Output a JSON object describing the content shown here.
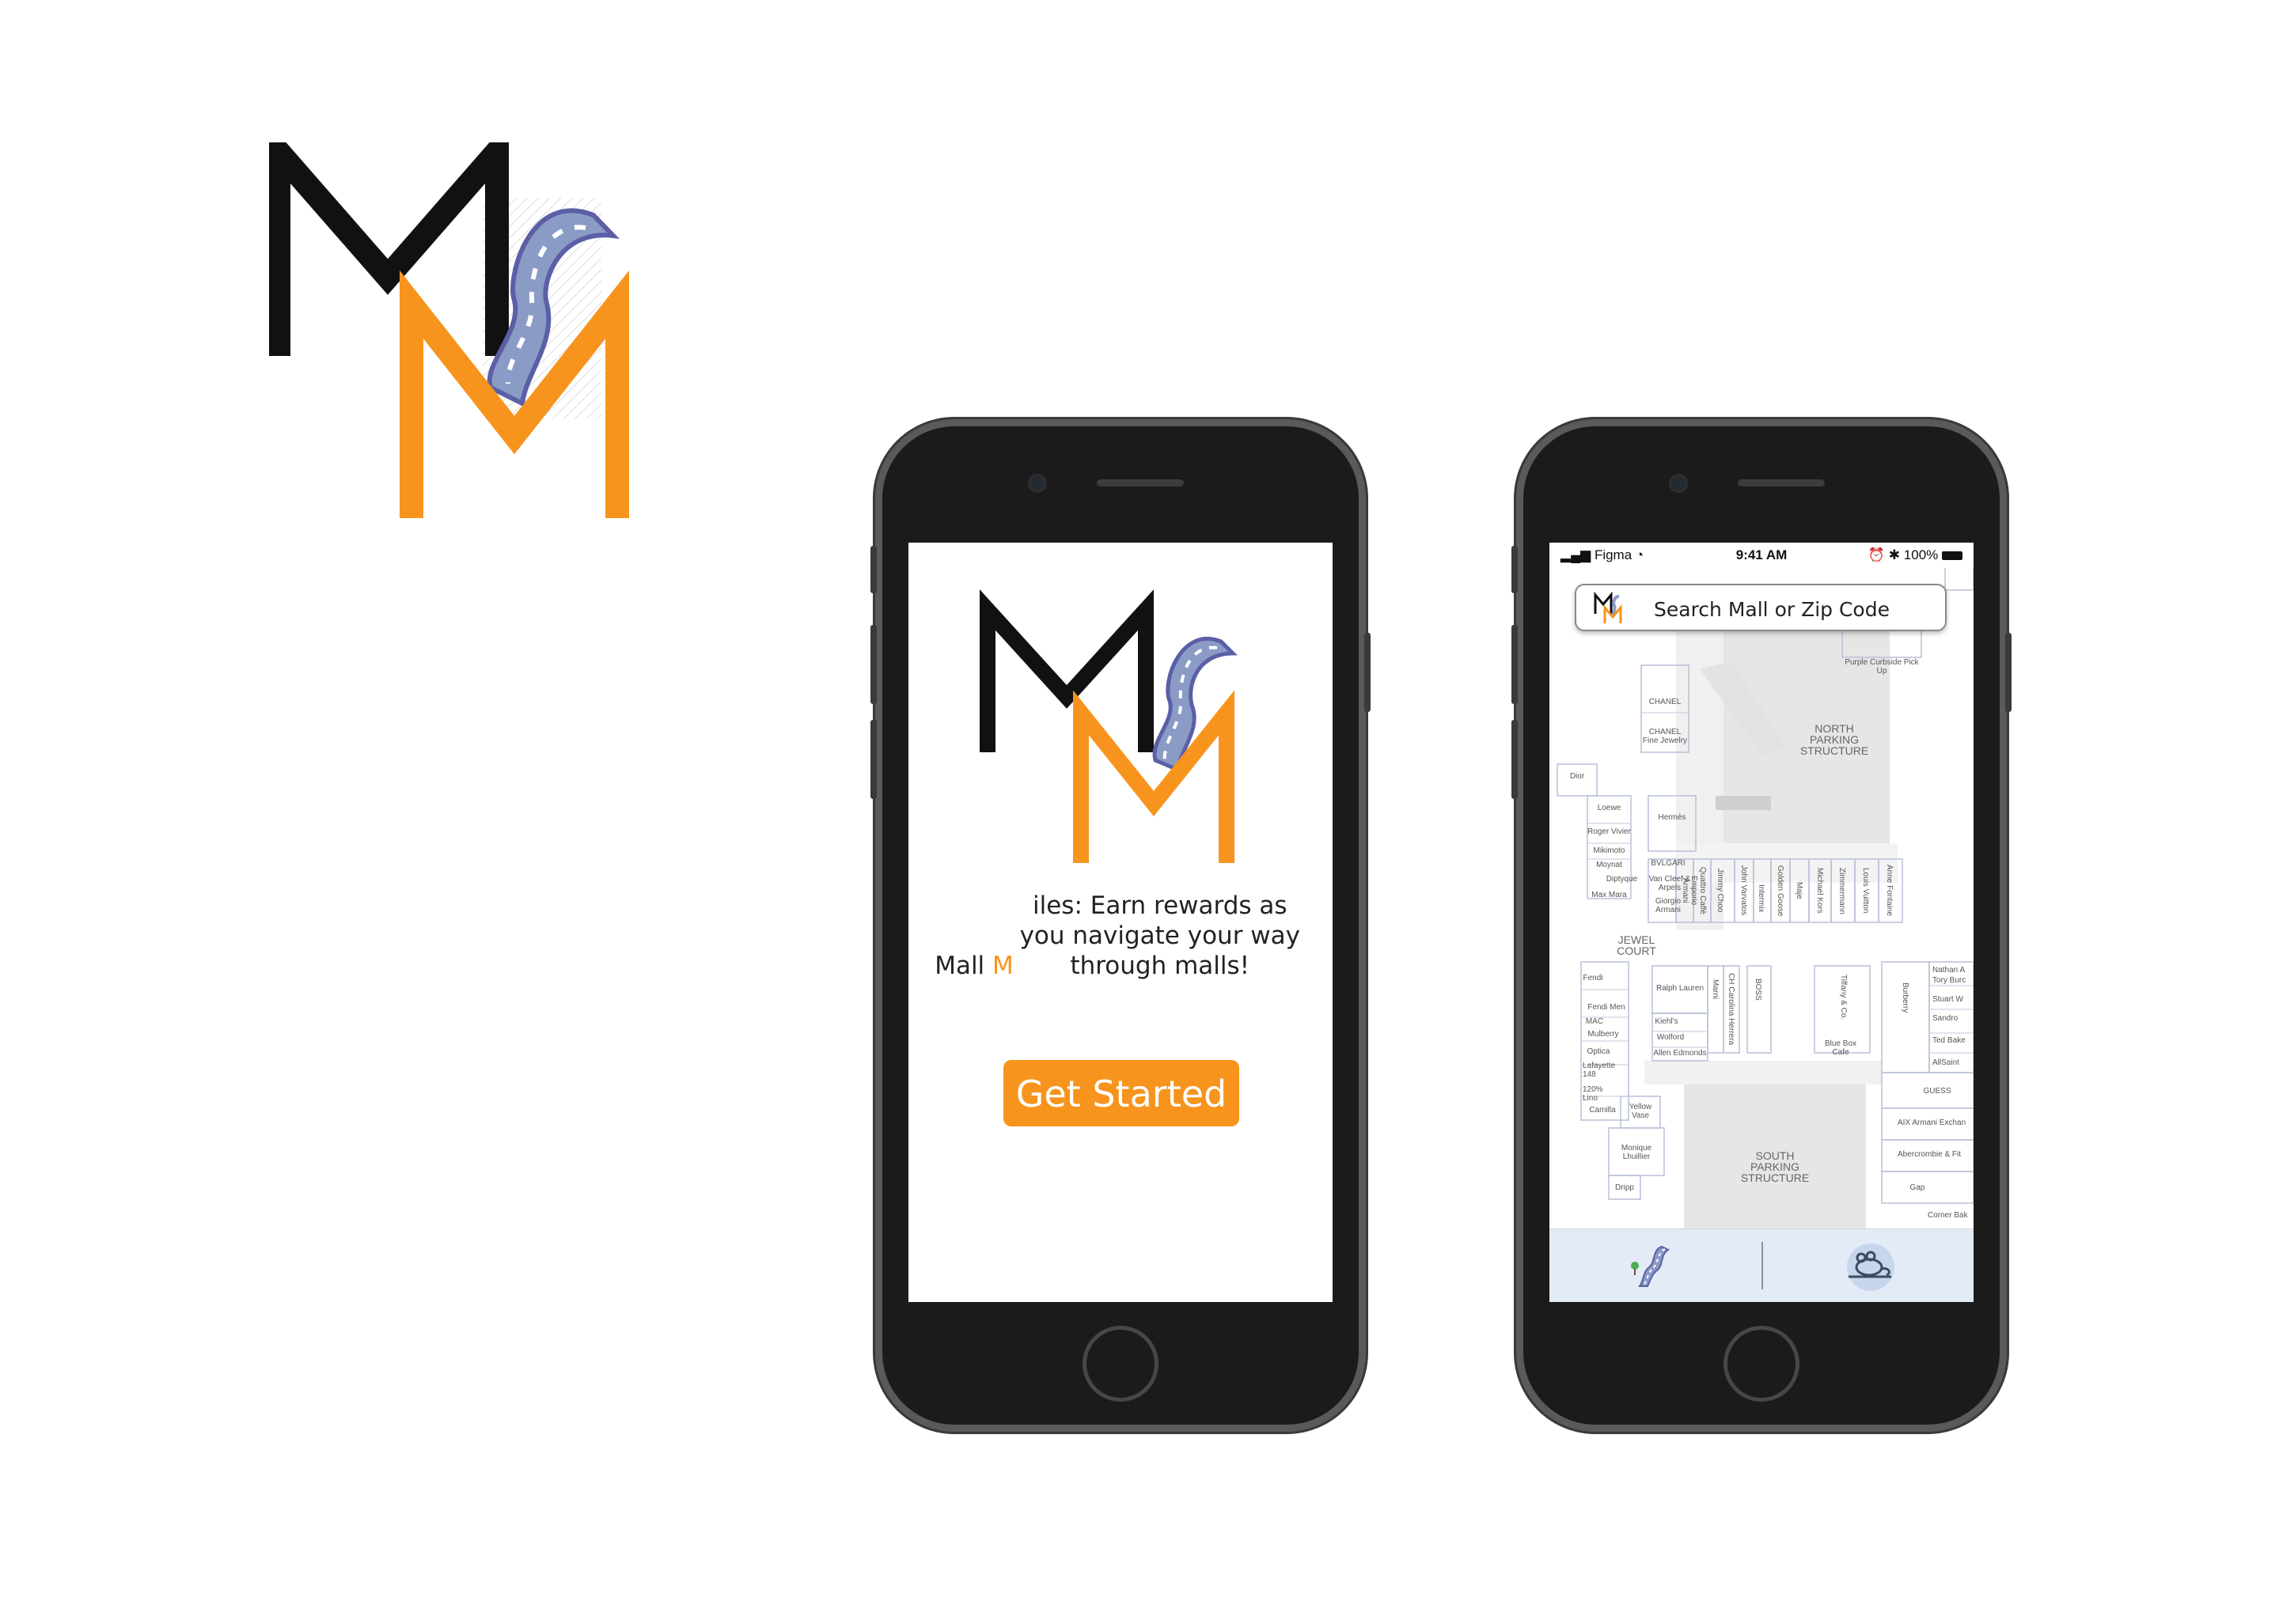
{
  "brand": {
    "logo_letters": "MM",
    "colors": {
      "black": "#111111",
      "orange": "#f7941d",
      "road": "#8a9bc6",
      "road_edge": "#5b5fa6"
    }
  },
  "welcome_screen": {
    "tagline_pre": "Mall ",
    "tagline_m": "M",
    "tagline_post": "iles: Earn rewards as you navigate your way through malls!",
    "cta_label": "Get Started"
  },
  "map_screen": {
    "status": {
      "carrier": "Figma",
      "time": "9:41 AM",
      "battery": "100%"
    },
    "search_placeholder": "Search Mall or Zip Code",
    "stores": {
      "chanel": "CHANEL",
      "chanel_fine": "CHANEL Fine Jewelry",
      "dior": "Dior",
      "loewe": "Loewe",
      "roger_vivier": "Roger Vivier",
      "mikimoto": "Mikimoto",
      "moynat": "Moynat",
      "diptyque": "Diptyque",
      "max_mara": "Max Mara",
      "hermes": "Hermès",
      "bvlgari": "BVLGARI",
      "van_cleef": "Van Cleef & Arpels",
      "giorgio": "Giorgio Armani",
      "emporio": "Emporio Armani",
      "quattro": "Quattro Caffè",
      "jimmy_choo": "Jimmy Choo",
      "john_varvatos": "John Varvatos",
      "intermix": "Intermix",
      "golden_goose": "Golden Goose",
      "maje": "Maje",
      "michael_kors": "Michael Kors",
      "zimmermann": "Zimmermann",
      "louis_vuitton": "Louis Vuitton",
      "anne_fontaine": "Anne Fontaine",
      "jewel_court": "JEWEL COURT",
      "fendi": "Fendi",
      "fendi_men": "Fendi Men",
      "mac": "MAC",
      "mulberry": "Mulberry",
      "optica": "Optica",
      "lafayette": "Lafayette 148",
      "line_120": "120% Lino",
      "camilla": "Camilla",
      "ralph_lauren": "Ralph Lauren",
      "kiehls": "Kiehl's",
      "wolford": "Wolford",
      "allen_edmonds": "Allen Edmonds",
      "marni": "Marni",
      "ch_carolina": "CH Carolina Herrera",
      "boss": "BOSS",
      "tiffany": "Tiffany & Co.",
      "blue_box": "Blue Box Cafe",
      "burberry": "Burberry",
      "nathan": "Nathan A",
      "tory_burch": "Tory Burc",
      "stuart": "Stuart W",
      "sandro": "Sandro",
      "ted_baker": "Ted Bake",
      "allsaints": "AllSaint",
      "guess": "GUESS",
      "aix": "AIX Armani Exchan",
      "abercrombie": "Abercrombie & Fit",
      "gap": "Gap",
      "corner_bakery": "Corner Bak",
      "yellow_vase": "Yellow Vase",
      "monique": "Monique Lhuillier",
      "dripp": "Dripp",
      "north_parking": "NORTH PARKING STRUCTURE",
      "south_parking": "SOUTH PARKING STRUCTURE",
      "purple_curbside": "Purple Curbside Pick Up"
    },
    "tabs": [
      {
        "icon": "road-icon"
      },
      {
        "icon": "mouse-car-icon"
      }
    ]
  }
}
